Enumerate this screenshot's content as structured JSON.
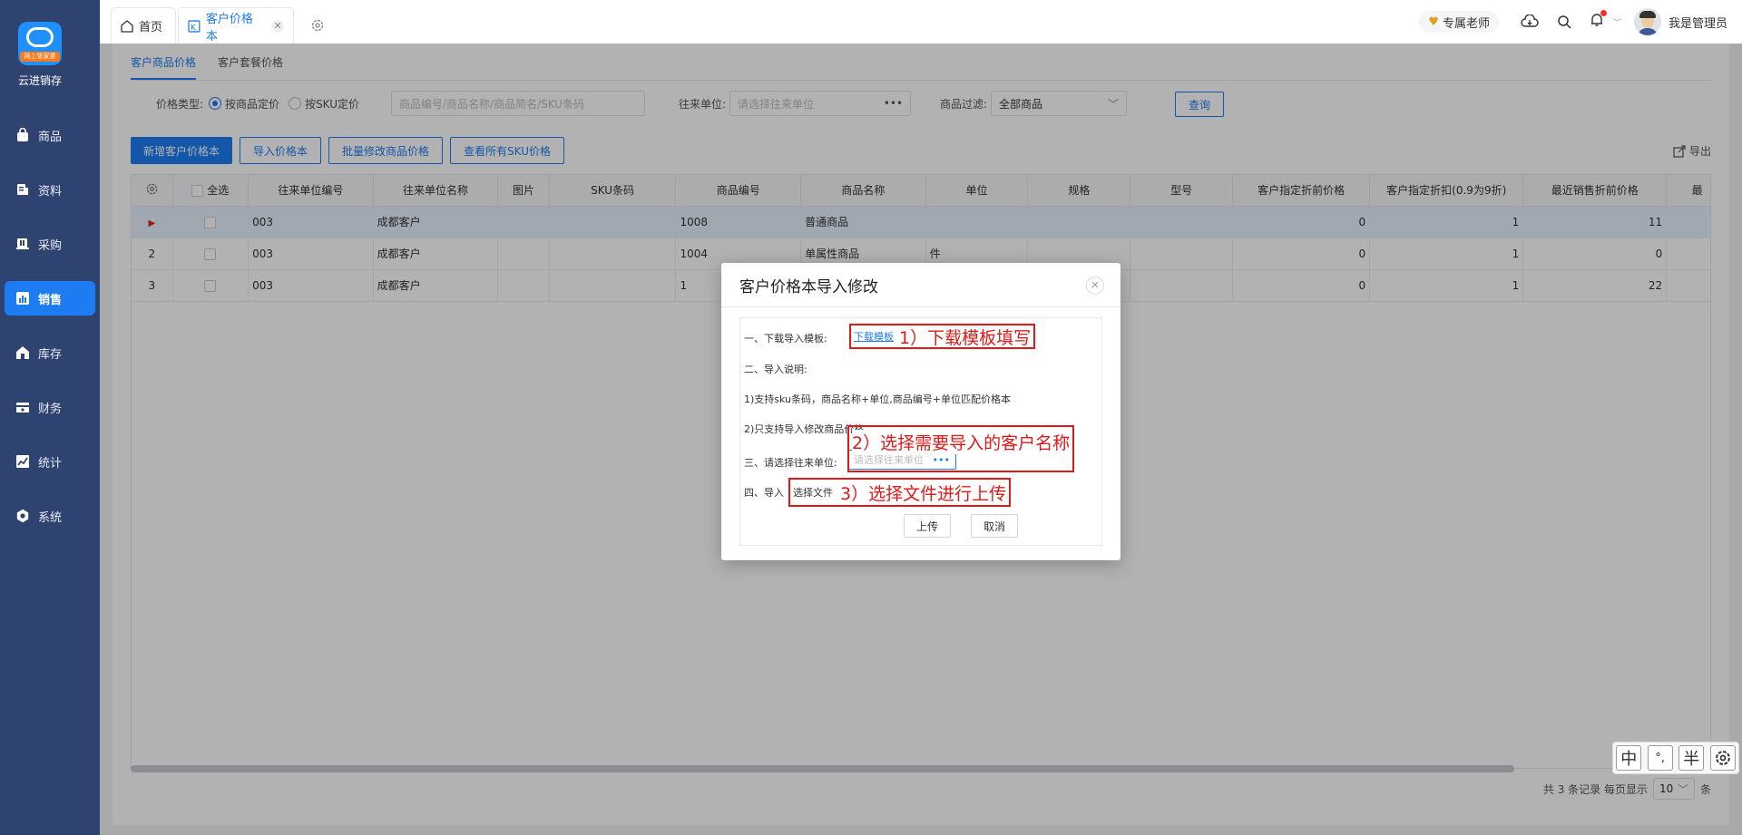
{
  "sidebar": {
    "logo_tag": "网上管家婆",
    "brand": "云进销存",
    "items": [
      {
        "label": "商品",
        "icon": "bag-icon"
      },
      {
        "label": "资料",
        "icon": "document-icon"
      },
      {
        "label": "采购",
        "icon": "purchase-icon"
      },
      {
        "label": "销售",
        "icon": "chart-icon"
      },
      {
        "label": "库存",
        "icon": "warehouse-icon"
      },
      {
        "label": "财务",
        "icon": "finance-icon"
      },
      {
        "label": "统计",
        "icon": "stats-icon"
      },
      {
        "label": "系统",
        "icon": "gear-icon"
      }
    ]
  },
  "topbar": {
    "tabs": [
      {
        "label": "首页"
      },
      {
        "label": "客户价格本"
      }
    ],
    "teacher_label": "专属老师",
    "user_name": "我是管理员"
  },
  "subtabs": [
    "客户商品价格",
    "客户套餐价格"
  ],
  "filters": {
    "price_type_label": "价格类型:",
    "option_product": "按商品定价",
    "option_sku": "按SKU定价",
    "search_placeholder": "商品编号/商品名称/商品简名/SKU条码",
    "unit_label": "往来单位:",
    "unit_placeholder": "请选择往来单位",
    "goods_filter_label": "商品过滤:",
    "goods_filter_value": "全部商品",
    "query_button": "查询"
  },
  "actions": {
    "add": "新增客户价格本",
    "import": "导入价格本",
    "batch_edit": "批量修改商品价格",
    "view_sku": "查看所有SKU价格",
    "export": "导出"
  },
  "table": {
    "select_all": "全选",
    "columns": [
      "往来单位编号",
      "往来单位名称",
      "图片",
      "SKU条码",
      "商品编号",
      "商品名称",
      "单位",
      "规格",
      "型号",
      "客户指定折前价格",
      "客户指定折扣(0.9为9折)",
      "最近销售折前价格",
      "最"
    ],
    "rows": [
      {
        "idx": "",
        "code": "003",
        "name": "成都客户",
        "pic": "",
        "sku": "",
        "pcode": "1008",
        "pname": "普通商品",
        "unit": "",
        "spec": "",
        "model": "",
        "price": "0",
        "discount": "1",
        "last": "11"
      },
      {
        "idx": "2",
        "code": "003",
        "name": "成都客户",
        "pic": "",
        "sku": "",
        "pcode": "1004",
        "pname": "单属性商品",
        "unit": "件",
        "spec": "",
        "model": "",
        "price": "0",
        "discount": "1",
        "last": "0"
      },
      {
        "idx": "3",
        "code": "003",
        "name": "成都客户",
        "pic": "",
        "sku": "",
        "pcode": "1",
        "pname": "",
        "unit": "",
        "spec": "",
        "model": "",
        "price": "0",
        "discount": "1",
        "last": "22"
      }
    ]
  },
  "pager": {
    "summary": "共 3 条记录  每页显示",
    "page_size": "10",
    "suffix": "条"
  },
  "modal": {
    "title": "客户价格本导入修改",
    "step1": "一、下载导入模板:",
    "download_link": "下载模板",
    "step2": "二、导入说明:",
    "note1": "1)支持sku条码，商品名称+单位,商品编号+单位匹配价格本",
    "note2": "2)只支持导入修改商品价格",
    "step3": "三、请选择往来单位:",
    "unit_placeholder": "请选择往来单位",
    "step4": "四、导入",
    "choose_file": "选择文件",
    "upload": "上传",
    "cancel": "取消",
    "annot1": "1）下载模板填写",
    "annot2": "2）选择需要导入的客户名称",
    "annot3": "3）选择文件进行上传"
  },
  "ime": [
    "中",
    "°,",
    "半"
  ]
}
